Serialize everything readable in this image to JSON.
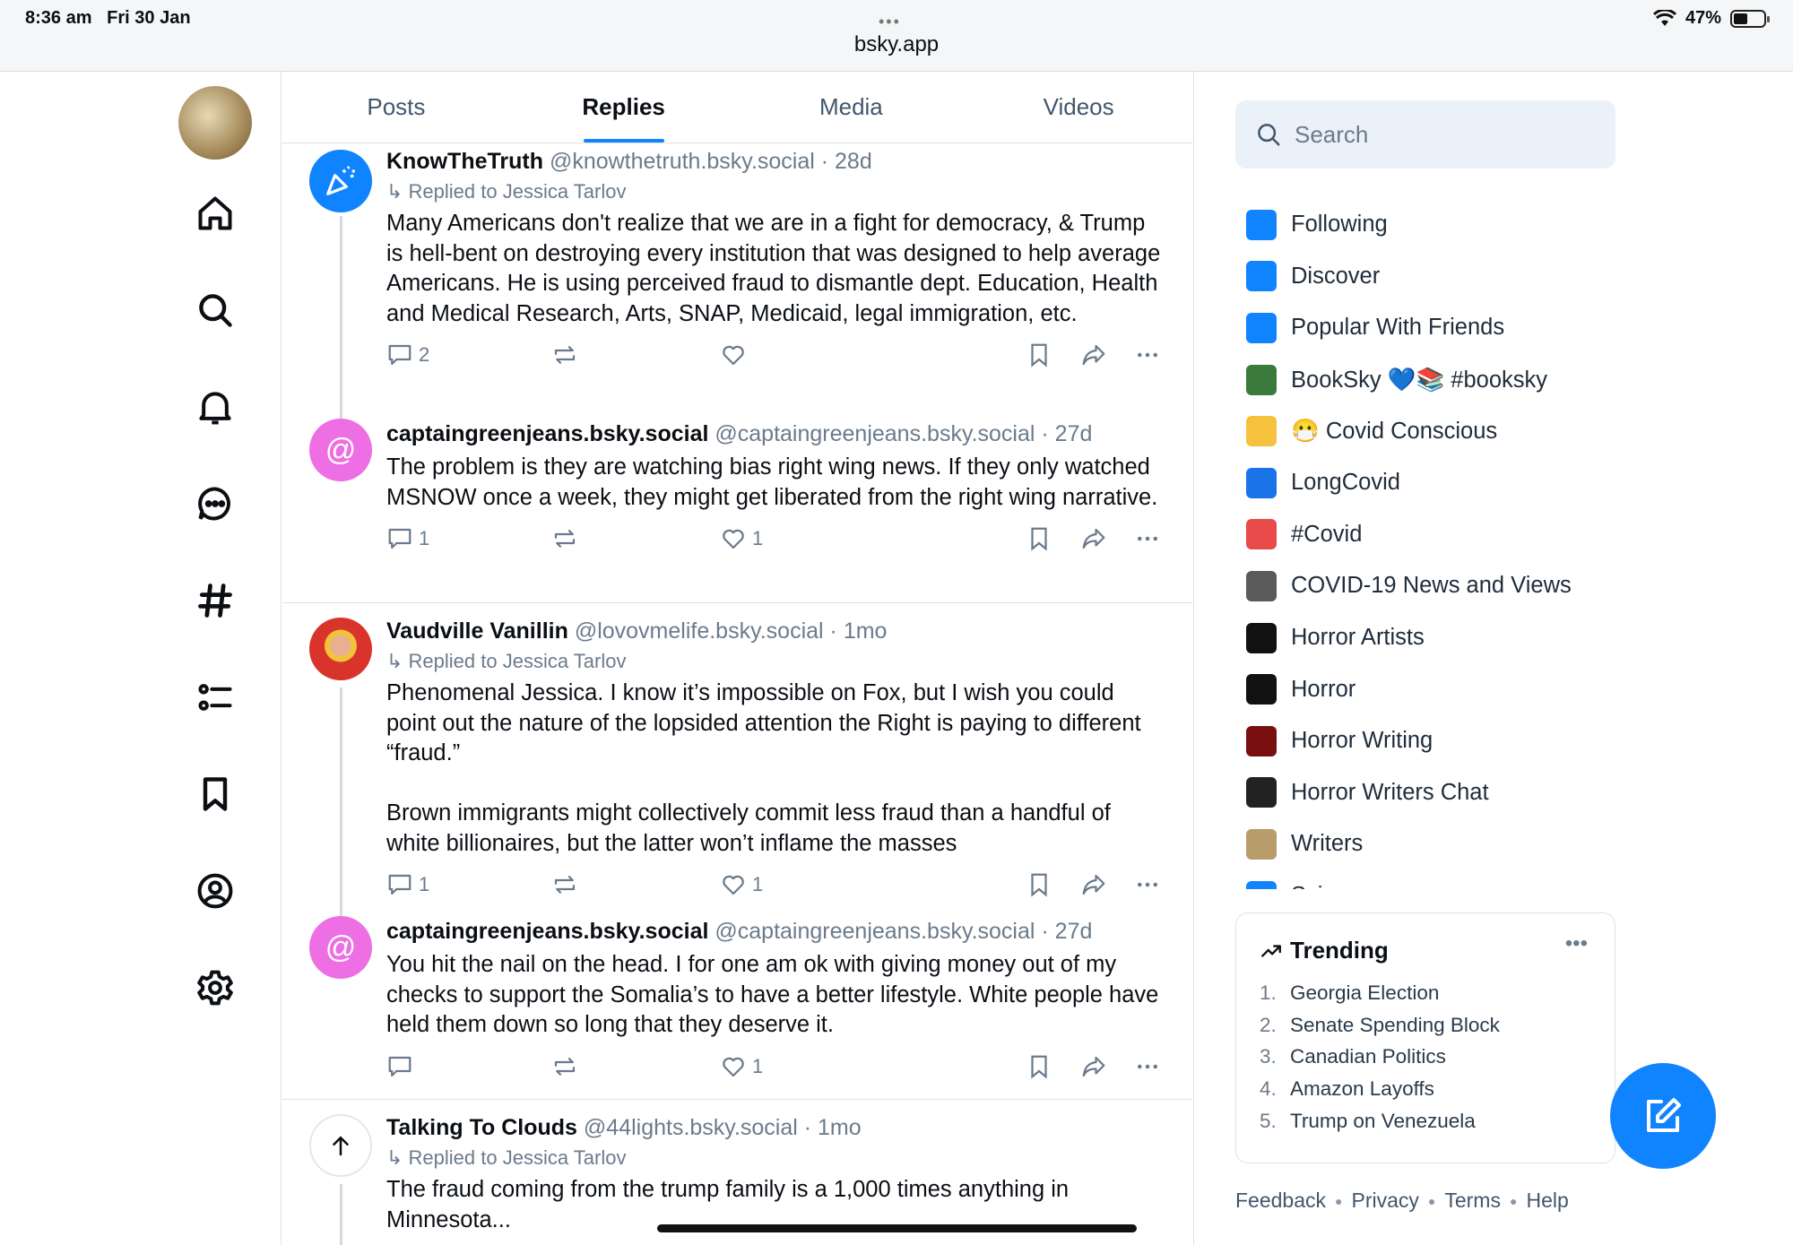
{
  "status": {
    "time": "8:36 am",
    "date": "Fri 30 Jan",
    "url": "bsky.app",
    "battery": "47%",
    "battery_level": 0.47
  },
  "tabs": [
    "Posts",
    "Replies",
    "Media",
    "Videos"
  ],
  "active_tab": "Replies",
  "posts": [
    {
      "name": "KnowTheTruth",
      "handle": "@knowthetruth.bsky.social",
      "time": "28d",
      "reply_to": "↳ Replied to Jessica Tarlov",
      "text": "Many Americans don't realize that we are in a fight for democracy, & Trump is hell-bent on destroying every institution that was designed to help average Americans. He is using perceived fraud to dismantle dept. Education, Health and Medical Research, Arts, SNAP, Medicaid, legal immigration, etc.",
      "replies": "2",
      "likes": "",
      "avatar_color": "#1083fe"
    },
    {
      "name": "captaingreenjeans.bsky.social",
      "handle": "@captaingreenjeans.bsky.social",
      "time": "27d",
      "reply_to": "",
      "text": "The problem is they are watching bias right wing news. If they only watched MSNOW once a week, they might get liberated from the right wing narrative.",
      "replies": "1",
      "likes": "1",
      "avatar_color": "#ee6fe4"
    },
    {
      "name": "Vaudville Vanillin",
      "handle": "@lovovmelife.bsky.social",
      "time": "1mo",
      "reply_to": "↳ Replied to Jessica Tarlov",
      "text": "Phenomenal Jessica. I know it’s impossible on Fox, but I wish you could point out the nature of the lopsided attention the Right is paying to different “fraud.”\n\nBrown immigrants might collectively commit less fraud than a handful of white billionaires, but the latter won’t inflame the masses",
      "replies": "1",
      "likes": "1",
      "avatar_color": "#d9342b"
    },
    {
      "name": "captaingreenjeans.bsky.social",
      "handle": "@captaingreenjeans.bsky.social",
      "time": "27d",
      "reply_to": "",
      "text": "You hit the nail on the head. I for one am ok with giving money out of my checks to support the Somalia’s to have a better lifestyle. White people have held them down so long that they deserve it.",
      "replies": "",
      "likes": "1",
      "avatar_color": "#ee6fe4"
    },
    {
      "name": "Talking To Clouds",
      "handle": "@44lights.bsky.social",
      "time": "1mo",
      "reply_to": "↳ Replied to Jessica Tarlov",
      "text": "The fraud coming from the trump family is a 1,000 times anything in Minnesota...",
      "replies": "",
      "likes": "",
      "avatar_color": "#ffffff"
    }
  ],
  "search": {
    "placeholder": "Search"
  },
  "feeds": [
    {
      "label": "Following",
      "color": "#1083fe",
      "icon": "sort-icon"
    },
    {
      "label": "Discover",
      "color": "#1083fe",
      "icon": "bluesky-icon"
    },
    {
      "label": "Popular With Friends",
      "color": "#1083fe",
      "icon": "heart-icon"
    },
    {
      "label": "BookSky 💙📚 #booksky",
      "color": "#3a7a3a",
      "icon": "books-icon"
    },
    {
      "label": "😷 Covid Conscious",
      "color": "#f6c23e",
      "icon": "mask-emoji-icon"
    },
    {
      "label": "LongCovid",
      "color": "#1a73e8",
      "icon": "longcovid-icon"
    },
    {
      "label": "#Covid",
      "color": "#e94b4b",
      "icon": "covid-banner-icon"
    },
    {
      "label": "COVID-19 News and Views",
      "color": "#5a5a5a",
      "icon": "virus-icon"
    },
    {
      "label": "Horror Artists",
      "color": "#111111",
      "icon": "ghost-icon"
    },
    {
      "label": "Horror",
      "color": "#111111",
      "icon": "ghost-icon"
    },
    {
      "label": "Horror Writing",
      "color": "#7a0f0f",
      "icon": "horror-writing-icon"
    },
    {
      "label": "Horror Writers Chat",
      "color": "#222222",
      "icon": "hwc-icon"
    },
    {
      "label": "Writers",
      "color": "#b89c6a",
      "icon": "paper-icon"
    },
    {
      "label": "Science",
      "color": "#1083fe",
      "icon": "science-icon"
    }
  ],
  "trending": {
    "title": "Trending",
    "items": [
      "Georgia Election",
      "Senate Spending Block",
      "Canadian Politics",
      "Amazon Layoffs",
      "Trump on Venezuela"
    ]
  },
  "footer": [
    "Feedback",
    "Privacy",
    "Terms",
    "Help"
  ]
}
